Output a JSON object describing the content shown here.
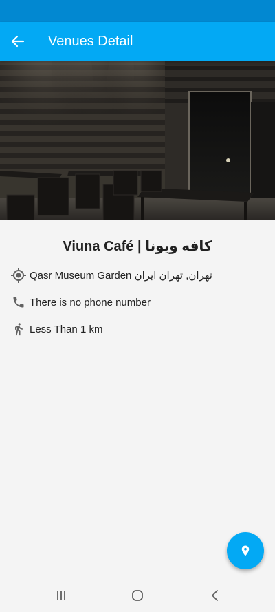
{
  "app_bar": {
    "title": "Venues Detail",
    "back_icon": "arrow-back-icon",
    "color": "#03a9f4",
    "status_bar_color": "#0288d1"
  },
  "venue": {
    "name": "Viuna Café | کافه ویونا",
    "address": "Qasr Museum Garden تهران, تهران ایران",
    "phone": "There is no phone number",
    "distance": "Less Than 1 km"
  },
  "icons": {
    "address": "my-location-icon",
    "phone": "phone-icon",
    "distance": "walking-person-icon",
    "fab": "map-pin-icon"
  },
  "system_nav": {
    "recents": "recent-apps-icon",
    "home": "home-icon",
    "back": "back-icon"
  }
}
